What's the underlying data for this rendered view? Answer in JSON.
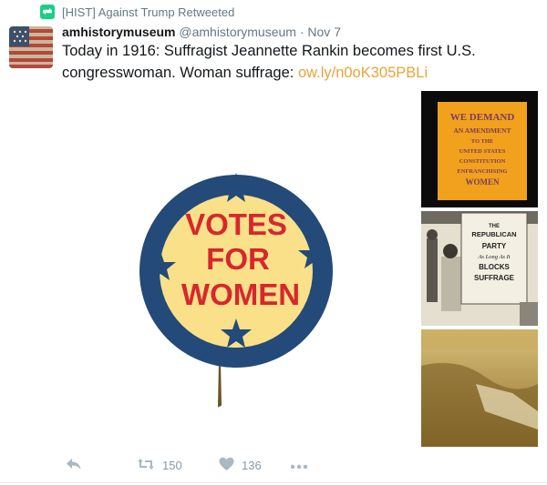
{
  "retweet": {
    "by": "[HIST] Against Trump Retweeted",
    "icon": "retweet-icon"
  },
  "tweet": {
    "author_name": "amhistorymuseum",
    "handle": "@amhistorymuseum",
    "separator": "·",
    "time": "Nov 7",
    "text": "Today in 1916: Suffragist Jeannette Rankin becomes first U.S. congresswoman. Woman suffrage: ",
    "link": "ow.ly/n0oK305PBLi"
  },
  "media": {
    "main_button": {
      "line1": "VOTES",
      "line2": "FOR",
      "line3": "WOMEN"
    },
    "banner": {
      "line1": "WE DEMAND",
      "line2": "AN AMENDMENT",
      "line3": "TO THE",
      "line4": "UNITED STATES",
      "line5": "CONSTITUTION",
      "line6": "ENFRANCHISING",
      "line7": "WOMEN"
    },
    "sign": {
      "line1": "THE",
      "line2": "REPUBLICAN",
      "line3": "PARTY",
      "line4": "As Long As It",
      "line5": "BLOCKS",
      "line6": "SUFFRAGE"
    }
  },
  "actions": {
    "reply_icon": "reply-icon",
    "retweets": "150",
    "likes": "136",
    "more_icon": "more-icon"
  },
  "colors": {
    "accent_link": "#e8a43a",
    "retweet_green": "#19cf86",
    "muted": "#657786",
    "button_navy": "#234a78",
    "button_yellow": "#fbe08a",
    "button_red": "#d6282c"
  }
}
